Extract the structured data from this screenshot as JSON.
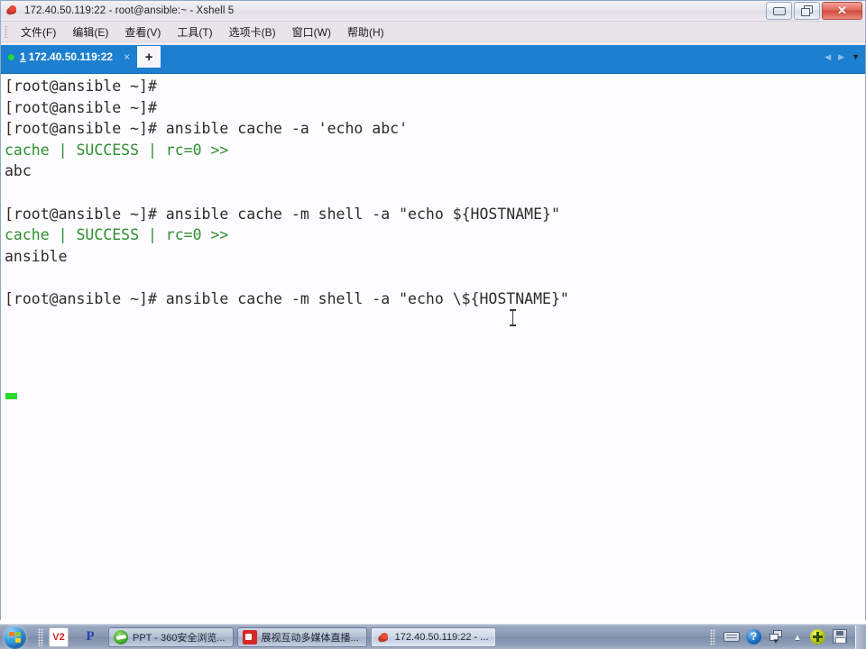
{
  "window": {
    "title": "172.40.50.119:22 - root@ansible:~ - Xshell 5",
    "app_icon": "xshell-icon",
    "caption": {
      "minimize": "minimize-button",
      "restore": "restore-button",
      "close_glyph": "✕"
    }
  },
  "menubar": {
    "items": [
      {
        "label": "文件(F)",
        "name": "menu-file"
      },
      {
        "label": "编辑(E)",
        "name": "menu-edit"
      },
      {
        "label": "查看(V)",
        "name": "menu-view"
      },
      {
        "label": "工具(T)",
        "name": "menu-tools"
      },
      {
        "label": "选项卡(B)",
        "name": "menu-tabs"
      },
      {
        "label": "窗口(W)",
        "name": "menu-window"
      },
      {
        "label": "帮助(H)",
        "name": "menu-help"
      }
    ]
  },
  "tabbar": {
    "tabs": [
      {
        "number": "1",
        "label": "172.40.50.119:22",
        "close_glyph": "×",
        "status_color": "#1ddb3a",
        "active": true
      }
    ],
    "new_tab_glyph": "+",
    "scroll_left_glyph": "◀",
    "scroll_right_glyph": "▶",
    "dropdown_glyph": "▼",
    "accent_color": "#1c7fd0"
  },
  "terminal": {
    "background": "#fdfcff",
    "foreground": "#2b2b2b",
    "success_color": "#2f8f2f",
    "cursor_color": "#28d82c",
    "lines": [
      {
        "text": "[root@ansible ~]#",
        "color": "fg"
      },
      {
        "text": "[root@ansible ~]#",
        "color": "fg"
      },
      {
        "text": "[root@ansible ~]# ansible cache -a 'echo abc'",
        "color": "fg"
      },
      {
        "text": "cache | SUCCESS | rc=0 >>",
        "color": "green"
      },
      {
        "text": "abc",
        "color": "fg"
      },
      {
        "text": "",
        "color": "fg"
      },
      {
        "text": "[root@ansible ~]# ansible cache -m shell -a \"echo ${HOSTNAME}\"",
        "color": "fg"
      },
      {
        "text": "cache | SUCCESS | rc=0 >>",
        "color": "green"
      },
      {
        "text": "ansible",
        "color": "fg"
      },
      {
        "text": "",
        "color": "fg"
      },
      {
        "text": "[root@ansible ~]# ansible cache -m shell -a \"echo \\${HOSTNAME}\"",
        "color": "fg"
      }
    ]
  },
  "taskbar": {
    "start_button": "start-orb",
    "quicklaunch": [
      {
        "name": "quicklaunch-v2",
        "label": "V2"
      },
      {
        "name": "quicklaunch-p",
        "label": "P"
      }
    ],
    "buttons": [
      {
        "label": "PPT - 360安全浏览...",
        "icon": "browser-icon",
        "active": false
      },
      {
        "label": "展视互动多媒体直播...",
        "icon": "broadcast-icon",
        "active": false
      },
      {
        "label": "172.40.50.119:22 - ...",
        "icon": "xshell-icon",
        "active": true
      }
    ],
    "tray": [
      {
        "name": "tray-keyboard-icon"
      },
      {
        "name": "tray-help-icon",
        "glyph": "?"
      },
      {
        "name": "tray-network-icon"
      },
      {
        "name": "tray-show-hidden-icon",
        "glyph": "▲"
      },
      {
        "name": "tray-update-icon"
      },
      {
        "name": "tray-save-icon"
      }
    ],
    "show_desktop": "show-desktop-button"
  }
}
